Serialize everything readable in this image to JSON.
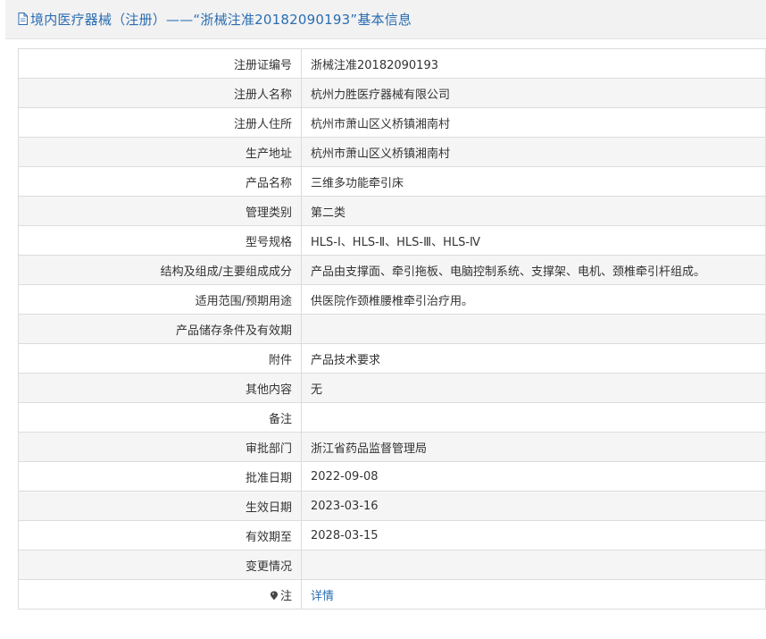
{
  "header": {
    "icon": "document-icon",
    "title": "境内医疗器械（注册）——“浙械注准20182090193”基本信息"
  },
  "rows": [
    {
      "label": "注册证编号",
      "value": "浙械注准20182090193"
    },
    {
      "label": "注册人名称",
      "value": "杭州力胜医疗器械有限公司"
    },
    {
      "label": "注册人住所",
      "value": "杭州市萧山区义桥镇湘南村"
    },
    {
      "label": "生产地址",
      "value": "杭州市萧山区义桥镇湘南村"
    },
    {
      "label": "产品名称",
      "value": "三维多功能牵引床"
    },
    {
      "label": "管理类别",
      "value": "第二类"
    },
    {
      "label": "型号规格",
      "value": "HLS-Ⅰ、HLS-Ⅱ、HLS-Ⅲ、HLS-Ⅳ"
    },
    {
      "label": "结构及组成/主要组成成分",
      "value": "产品由支撑面、牵引拖板、电脑控制系统、支撑架、电机、颈椎牵引杆组成。"
    },
    {
      "label": "适用范围/预期用途",
      "value": "供医院作颈椎腰椎牵引治疗用。"
    },
    {
      "label": "产品储存条件及有效期",
      "value": ""
    },
    {
      "label": "附件",
      "value": "产品技术要求"
    },
    {
      "label": "其他内容",
      "value": "无"
    },
    {
      "label": "备注",
      "value": ""
    },
    {
      "label": "审批部门",
      "value": "浙江省药品监督管理局"
    },
    {
      "label": "批准日期",
      "value": "2022-09-08"
    },
    {
      "label": "生效日期",
      "value": "2023-03-16"
    },
    {
      "label": "有效期至",
      "value": "2028-03-15"
    },
    {
      "label": "变更情况",
      "value": ""
    }
  ],
  "note_row": {
    "icon": "pin-icon",
    "label": "注",
    "link_text": "详情"
  }
}
